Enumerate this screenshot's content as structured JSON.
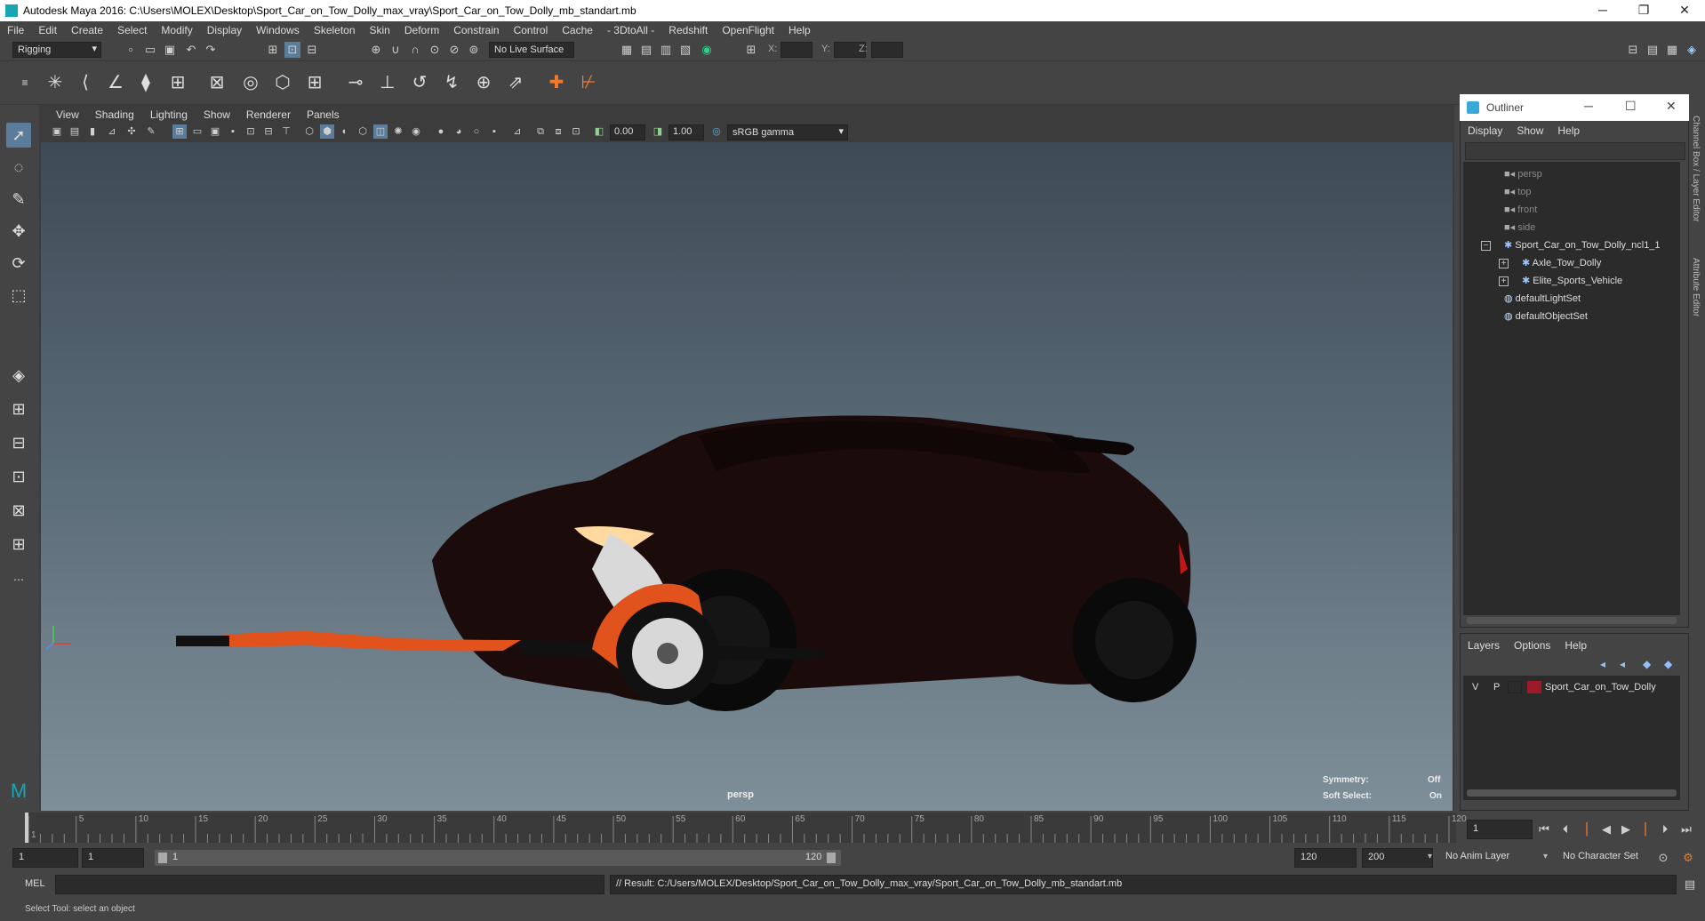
{
  "window": {
    "title": "Autodesk Maya 2016: C:\\Users\\MOLEX\\Desktop\\Sport_Car_on_Tow_Dolly_max_vray\\Sport_Car_on_Tow_Dolly_mb_standart.mb",
    "minimize": "─",
    "restore": "❐",
    "close": "✕"
  },
  "menubar": [
    "File",
    "Edit",
    "Create",
    "Select",
    "Modify",
    "Display",
    "Windows",
    "Skeleton",
    "Skin",
    "Deform",
    "Constrain",
    "Control",
    "Cache",
    "- 3DtoAll -",
    "Redshift",
    "OpenFlight",
    "Help"
  ],
  "statusline": {
    "menu_set": "Rigging",
    "live_surface": "No Live Surface",
    "x_label": "X:",
    "y_label": "Y:",
    "z_label": "Z:"
  },
  "viewport": {
    "menu": [
      "View",
      "Shading",
      "Lighting",
      "Show",
      "Renderer",
      "Panels"
    ],
    "exposure": "0.00",
    "gamma": "1.00",
    "color_space": "sRGB gamma",
    "camera_label": "persp",
    "symmetry_label": "Symmetry:",
    "symmetry_value": "Off",
    "soft_select_label": "Soft Select:",
    "soft_select_value": "On"
  },
  "outliner": {
    "title": "Outliner",
    "menu": [
      "Display",
      "Show",
      "Help"
    ],
    "items": [
      {
        "label": "persp",
        "dim": true
      },
      {
        "label": "top",
        "dim": true
      },
      {
        "label": "front",
        "dim": true
      },
      {
        "label": "side",
        "dim": true
      },
      {
        "label": "Sport_Car_on_Tow_Dolly_ncl1_1",
        "dim": false
      },
      {
        "label": "Axle_Tow_Dolly",
        "dim": false
      },
      {
        "label": "Elite_Sports_Vehicle",
        "dim": false
      },
      {
        "label": "defaultLightSet",
        "dim": false
      },
      {
        "label": "defaultObjectSet",
        "dim": false
      }
    ]
  },
  "layers": {
    "menu": [
      "Layers",
      "Options",
      "Help"
    ],
    "layer": {
      "v": "V",
      "p": "P",
      "name": "Sport_Car_on_Tow_Dolly",
      "color": "#9b1b2a"
    }
  },
  "side_tabs": {
    "channel_box": "Channel Box / Layer Editor",
    "attribute_editor": "Attribute Editor"
  },
  "timeslider": {
    "ticks": [
      "1",
      "5",
      "10",
      "15",
      "20",
      "25",
      "30",
      "35",
      "40",
      "45",
      "50",
      "55",
      "60",
      "65",
      "70",
      "75",
      "80",
      "85",
      "90",
      "95",
      "100",
      "105",
      "110",
      "115",
      "120"
    ],
    "current_frame": "1"
  },
  "rangeslider": {
    "start": "1",
    "anim_start": "1",
    "range_start_label": "1",
    "range_end_label": "120",
    "anim_end": "120",
    "end": "200",
    "anim_layer": "No Anim Layer",
    "character_set": "No Character Set"
  },
  "cmdline": {
    "label": "MEL",
    "result": "// Result: C:/Users/MOLEX/Desktop/Sport_Car_on_Tow_Dolly_max_vray/Sport_Car_on_Tow_Dolly_mb_standart.mb"
  },
  "helpline": "Select Tool: select an object",
  "colors": {
    "accent": "#f07a2a",
    "selected_tool": "#5c7c9c",
    "layer_color": "#9b1b2a"
  }
}
